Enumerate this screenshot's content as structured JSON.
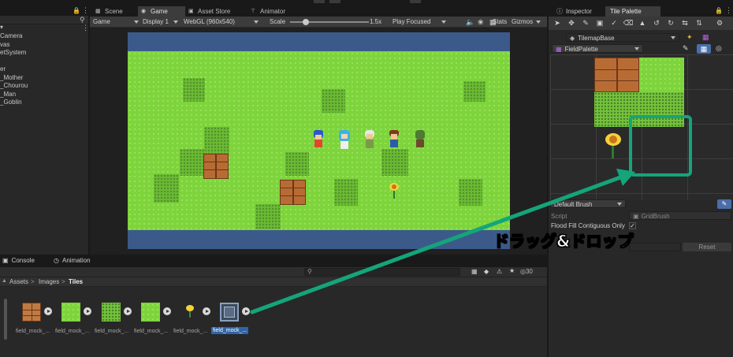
{
  "hierarchy": {
    "items": [
      "Camera",
      "vas",
      "etSystem",
      "",
      "er",
      "_Mother",
      "_Chourou",
      "_Man",
      "_Goblin"
    ]
  },
  "center": {
    "tabs": [
      "Scene",
      "Game",
      "Asset Store",
      "Animator"
    ],
    "toolbar": {
      "mode": "Game",
      "display": "Display 1",
      "resolution": "WebGL (960x540)",
      "scale_label": "Scale",
      "scale_value": "1.5x",
      "play_mode": "Play Focused",
      "stats": "Stats",
      "gizmos": "Gizmos"
    }
  },
  "right": {
    "tabs": [
      "Inspector",
      "Tile Palette"
    ],
    "tilemap": "TilemapBase",
    "palette": "FieldPalette",
    "brush": "Default Brush",
    "script_label": "Script",
    "script_value": "GridBrush",
    "flood_fill_label": "Flood Fill Contiguous Only",
    "reset_label": "Reset"
  },
  "bottom": {
    "tabs": [
      "Console",
      "Animation"
    ],
    "breadcrumb": [
      "Assets",
      "Images",
      "Tiles"
    ],
    "count": "30",
    "assets": [
      "field_mock_...",
      "field_mock_...",
      "field_mock_...",
      "field_mock_...",
      "field_mock_...",
      "field_mock_..."
    ]
  },
  "annotation": {
    "text": "ドラッグ&ドロップ",
    "color": "#14a57a"
  },
  "colors": {
    "grass": "#7ed43c",
    "water": "#3b5a8a",
    "selected_label": "#2f65a8"
  }
}
